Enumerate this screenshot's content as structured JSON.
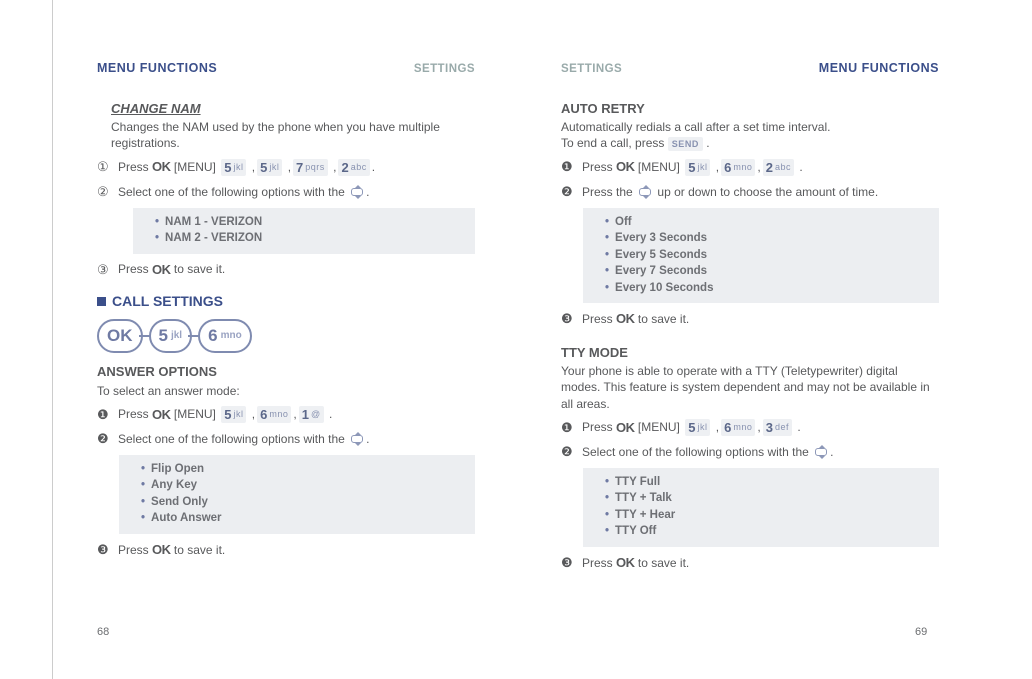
{
  "left": {
    "header": {
      "menu_functions": "MENU FUNCTIONS",
      "settings": "SETTINGS"
    },
    "change_nam": {
      "title": "CHANGE NAM",
      "desc": "Changes the NAM used by the phone when you have multiple registrations.",
      "step1": {
        "num": "①",
        "press": "Press",
        "ok": "OK",
        "menu": "[MENU]",
        "k1d": "5",
        "k1l": "jkl",
        "k2d": "5",
        "k2l": "jkl",
        "k3d": "7",
        "k3l": "pqrs",
        "k4d": "2",
        "k4l": "abc",
        "dot": "."
      },
      "step2": {
        "num": "②",
        "text": "Select one of the following options with the",
        "dot": "."
      },
      "options": {
        "a": "NAM 1 - VERIZON",
        "b": "NAM 2 - VERIZON"
      },
      "step3": {
        "num": "③",
        "press": "Press",
        "ok": "OK",
        "rest": "to save it."
      }
    },
    "call_settings_title": "CALL SETTINGS",
    "pillrow": {
      "a": "OK",
      "bD": "5",
      "bL": "jkl",
      "cD": "6",
      "cL": "mno"
    },
    "answer_options": {
      "title": "ANSWER OPTIONS",
      "intro": "To select an answer mode:",
      "step1": {
        "num": "❶",
        "press": "Press",
        "ok": "OK",
        "menu": "[MENU]",
        "k1d": "5",
        "k1l": "jkl",
        "k2d": "6",
        "k2l": "mno",
        "k3d": "1",
        "k3l": "@",
        "dot": "."
      },
      "step2": {
        "num": "❷",
        "text": "Select one of the following options with the",
        "dot": "."
      },
      "options": {
        "a": "Flip Open",
        "b": "Any Key",
        "c": "Send Only",
        "d": "Auto Answer"
      },
      "step3": {
        "num": "❸",
        "press": "Press",
        "ok": "OK",
        "rest": "to save it."
      }
    },
    "page_number": "68"
  },
  "right": {
    "header": {
      "settings": "SETTINGS",
      "menu_functions": "MENU FUNCTIONS"
    },
    "auto_retry": {
      "title": "AUTO RETRY",
      "line1": "Automatically redials a call after a set time interval.",
      "line2a": "To end a call, press",
      "send": "SEND",
      "line2b": ".",
      "step1": {
        "num": "❶",
        "press": "Press",
        "ok": "OK",
        "menu": "[MENU]",
        "k1d": "5",
        "k1l": "jkl",
        "k2d": "6",
        "k2l": "mno",
        "k3d": "2",
        "k3l": "abc",
        "dot": "."
      },
      "step2": {
        "num": "❷",
        "a": "Press the",
        "b": "up or down to choose the amount of time."
      },
      "options": {
        "a": "Off",
        "b": "Every 3 Seconds",
        "c": "Every 5 Seconds",
        "d": "Every 7 Seconds",
        "e": "Every 10 Seconds"
      },
      "step3": {
        "num": "❸",
        "press": "Press",
        "ok": "OK",
        "rest": "to save it."
      }
    },
    "tty": {
      "title": "TTY MODE",
      "desc": "Your phone is able to operate with a TTY (Teletypewriter) digital modes. This feature is system dependent and may not be available in all areas.",
      "step1": {
        "num": "❶",
        "press": "Press",
        "ok": "OK",
        "menu": "[MENU]",
        "k1d": "5",
        "k1l": "jkl",
        "k2d": "6",
        "k2l": "mno",
        "k3d": "3",
        "k3l": "def",
        "dot": "."
      },
      "step2": {
        "num": "❷",
        "text": "Select one of the following options with the",
        "dot": "."
      },
      "options": {
        "a": "TTY Full",
        "b": "TTY + Talk",
        "c": "TTY + Hear",
        "d": "TTY Off"
      },
      "step3": {
        "num": "❸",
        "press": "Press",
        "ok": "OK",
        "rest": "to save it."
      }
    },
    "page_number": "69"
  }
}
